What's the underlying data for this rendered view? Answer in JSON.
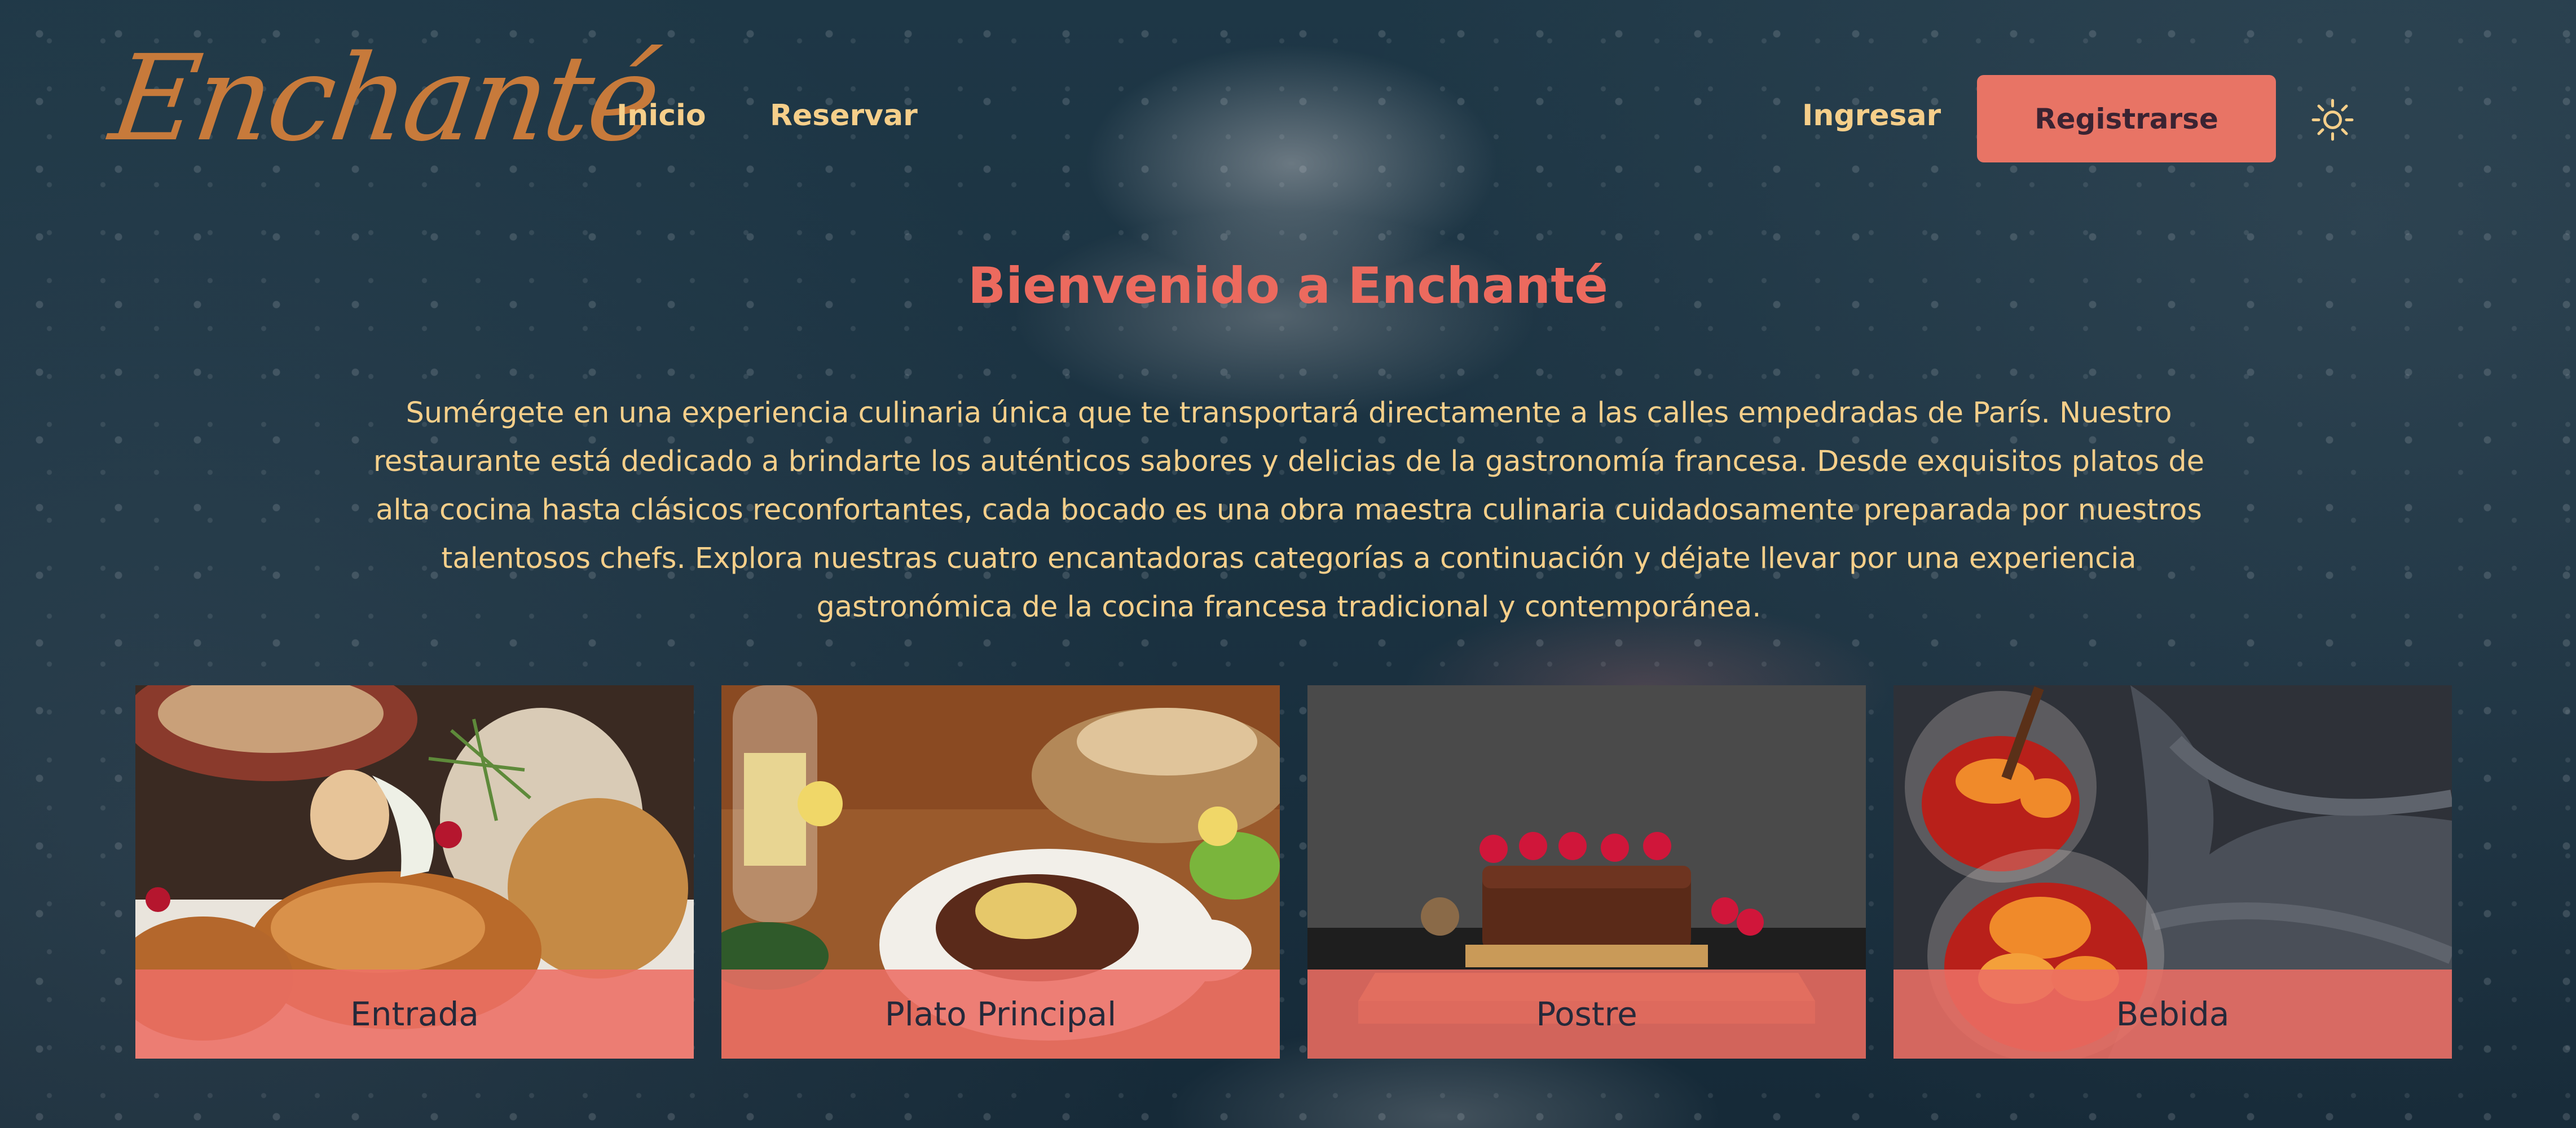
{
  "header": {
    "logo_text": "Enchanté",
    "nav": {
      "inicio": "Inicio",
      "reservar": "Reservar"
    },
    "login_label": "Ingresar",
    "register_label": "Registrarse",
    "theme_icon": "sun-icon"
  },
  "hero": {
    "title": "Bienvenido a Enchanté",
    "description": "Sumérgete en una experiencia culinaria única que te transportará directamente a las calles empedradas de París. Nuestro restaurante está dedicado a brindarte los auténticos sabores y delicias de la gastronomía francesa. Desde exquisitos platos de alta cocina hasta clásicos reconfortantes, cada bocado es una obra maestra culinaria cuidadosamente preparada por nuestros talentosos chefs. Explora nuestras cuatro encantadoras categorías a continuación y déjate llevar por una experiencia gastronómica de la cocina francesa tradicional y contemporánea."
  },
  "categories": [
    {
      "label": "Entrada",
      "image": "appetizer-photo"
    },
    {
      "label": "Plato Principal",
      "image": "main-course-photo"
    },
    {
      "label": "Postre",
      "image": "dessert-photo"
    },
    {
      "label": "Bebida",
      "image": "drink-photo"
    }
  ],
  "colors": {
    "background": "#1e3746",
    "accent": "#e87465",
    "title": "#ec6a5e",
    "text": "#f6cf8a",
    "logo": "#c77a3b"
  }
}
